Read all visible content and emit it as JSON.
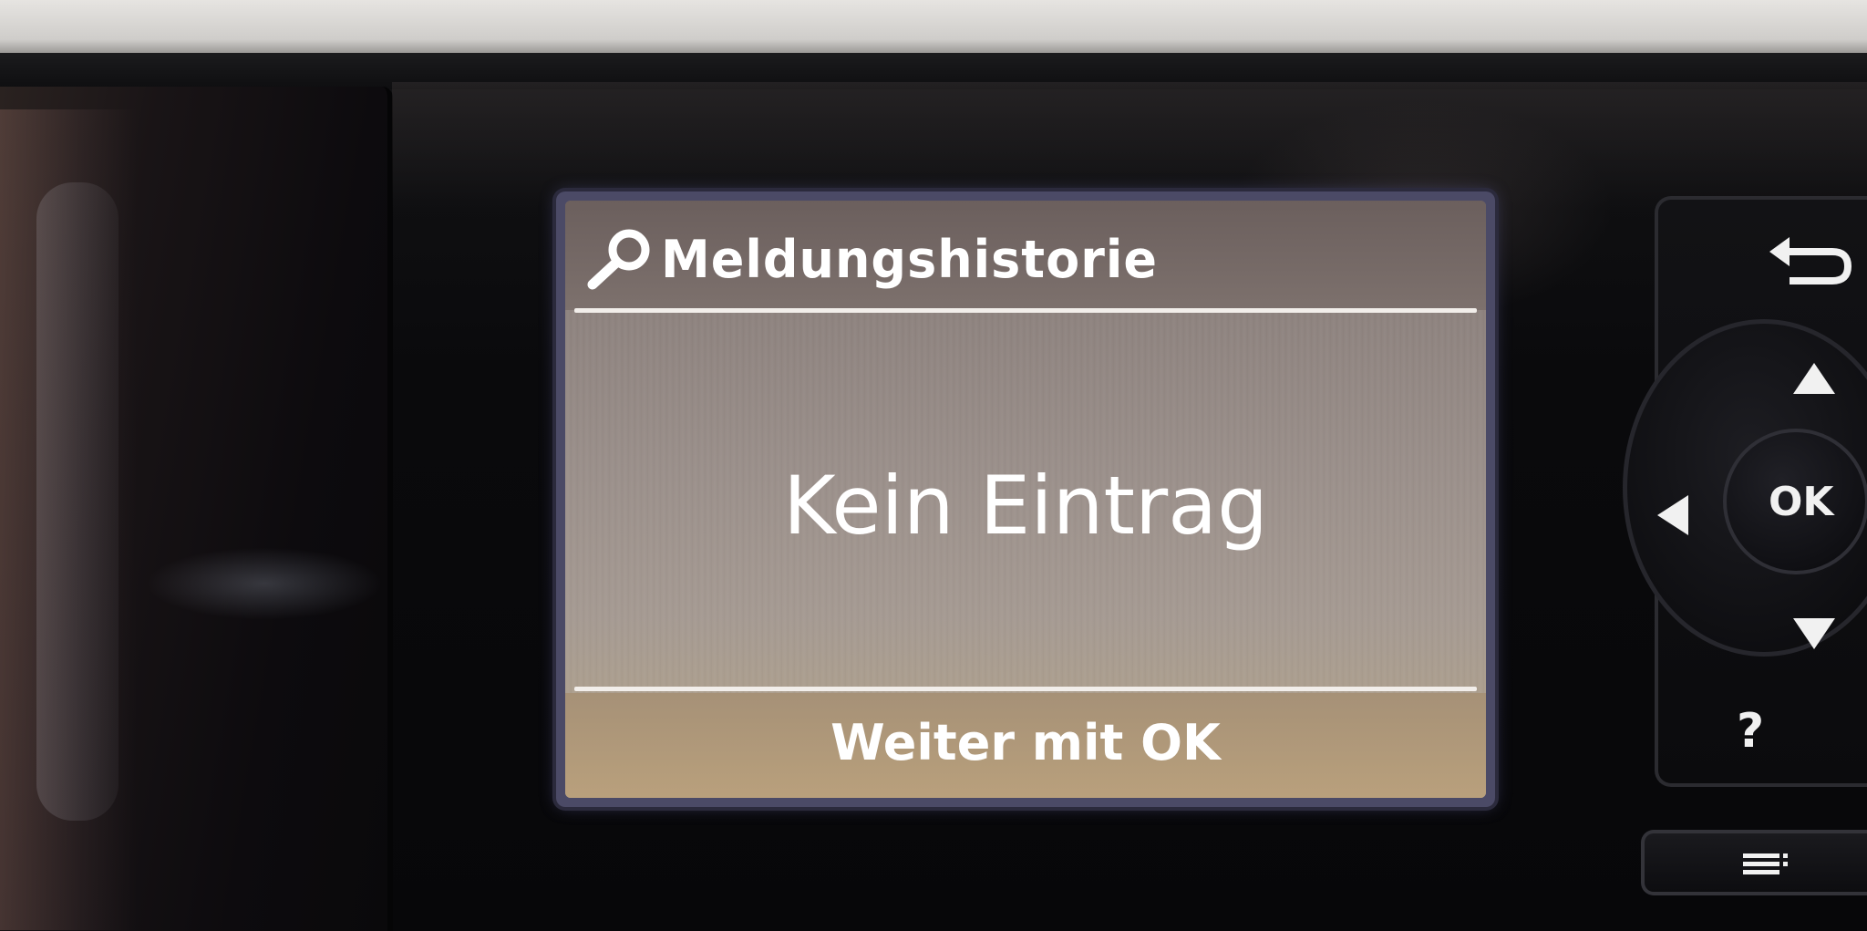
{
  "screen": {
    "title": "Meldungshistorie",
    "message": "Kein Eintrag",
    "hint": "Weiter mit OK",
    "title_icon": "search-icon"
  },
  "controls": {
    "ok_label": "OK",
    "help_label": "?",
    "back_icon": "back-arrow-icon",
    "up_icon": "up-arrow-icon",
    "down_icon": "down-arrow-icon",
    "left_icon": "left-arrow-icon",
    "menu_icon": "menu-icon"
  },
  "colors": {
    "lcd_text": "#ffffff",
    "lcd_background": "#9a8f8a",
    "panel_black": "#0b0b0d"
  }
}
